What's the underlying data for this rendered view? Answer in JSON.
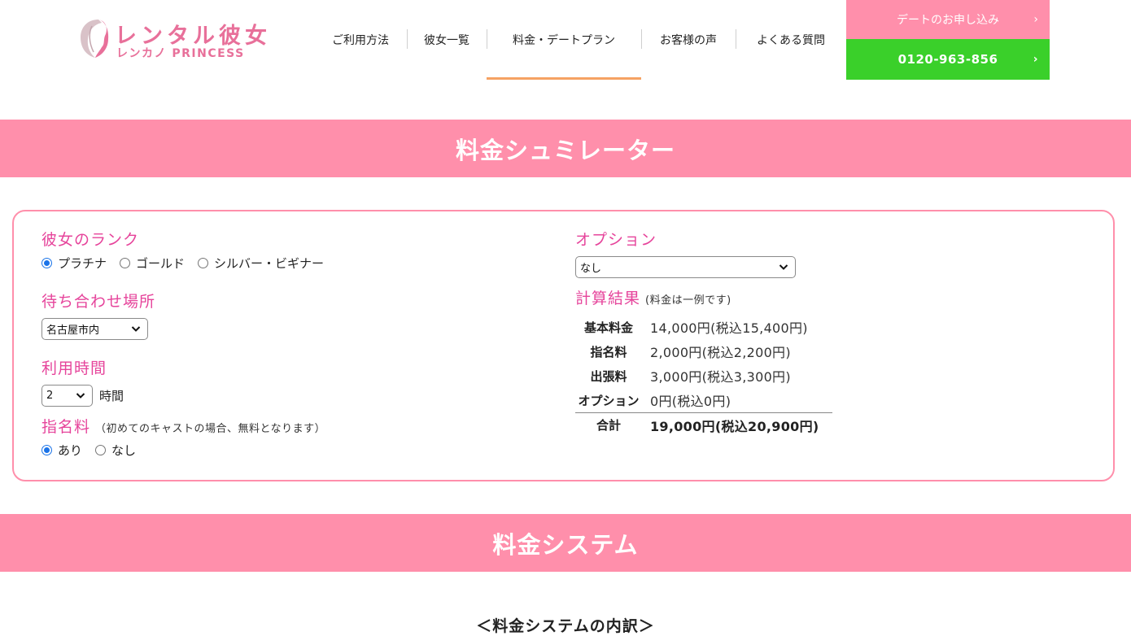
{
  "header": {
    "logo_title": "レンタル彼女",
    "logo_sub": "レンカノ PRINCESS",
    "nav": [
      "ご利用方法",
      "彼女一覧",
      "料金・デートプラン",
      "お客様の声",
      "よくある質問"
    ],
    "cta_apply": "デートのお申し込み",
    "cta_phone": "0120-963-856"
  },
  "sections": {
    "simulator_title": "料金シュミレーター",
    "system_title": "料金システム",
    "system_subhead": "＜料金システムの内訳＞"
  },
  "simulator": {
    "rank": {
      "label": "彼女のランク",
      "options": [
        "プラチナ",
        "ゴールド",
        "シルバー・ビギナー"
      ],
      "selected": "プラチナ"
    },
    "location": {
      "label": "待ち合わせ場所",
      "value": "名古屋市内"
    },
    "hours": {
      "label": "利用時間",
      "value": "2",
      "unit": "時間"
    },
    "nomination": {
      "label": "指名料",
      "note": "（初めてのキャストの場合、無料となります）",
      "options": [
        "あり",
        "なし"
      ],
      "selected": "あり"
    },
    "option": {
      "label": "オプション",
      "value": "なし"
    },
    "result": {
      "label": "計算結果",
      "note": "(料金は一例です)",
      "rows": [
        {
          "name": "基本料金",
          "value": "14,000円(税込15,400円)"
        },
        {
          "name": "指名料",
          "value": "2,000円(税込2,200円)"
        },
        {
          "name": "出張料",
          "value": "3,000円(税込3,300円)"
        },
        {
          "name": "オプション",
          "value": "0円(税込0円)"
        }
      ],
      "total": {
        "name": "合計",
        "value": "19,000円(税込20,900円)"
      }
    }
  },
  "colors": {
    "brand_pink": "#ff8fab",
    "label_pink": "#e6449b",
    "phone_green": "#3ad02a",
    "nav_active": "#f6a263"
  }
}
